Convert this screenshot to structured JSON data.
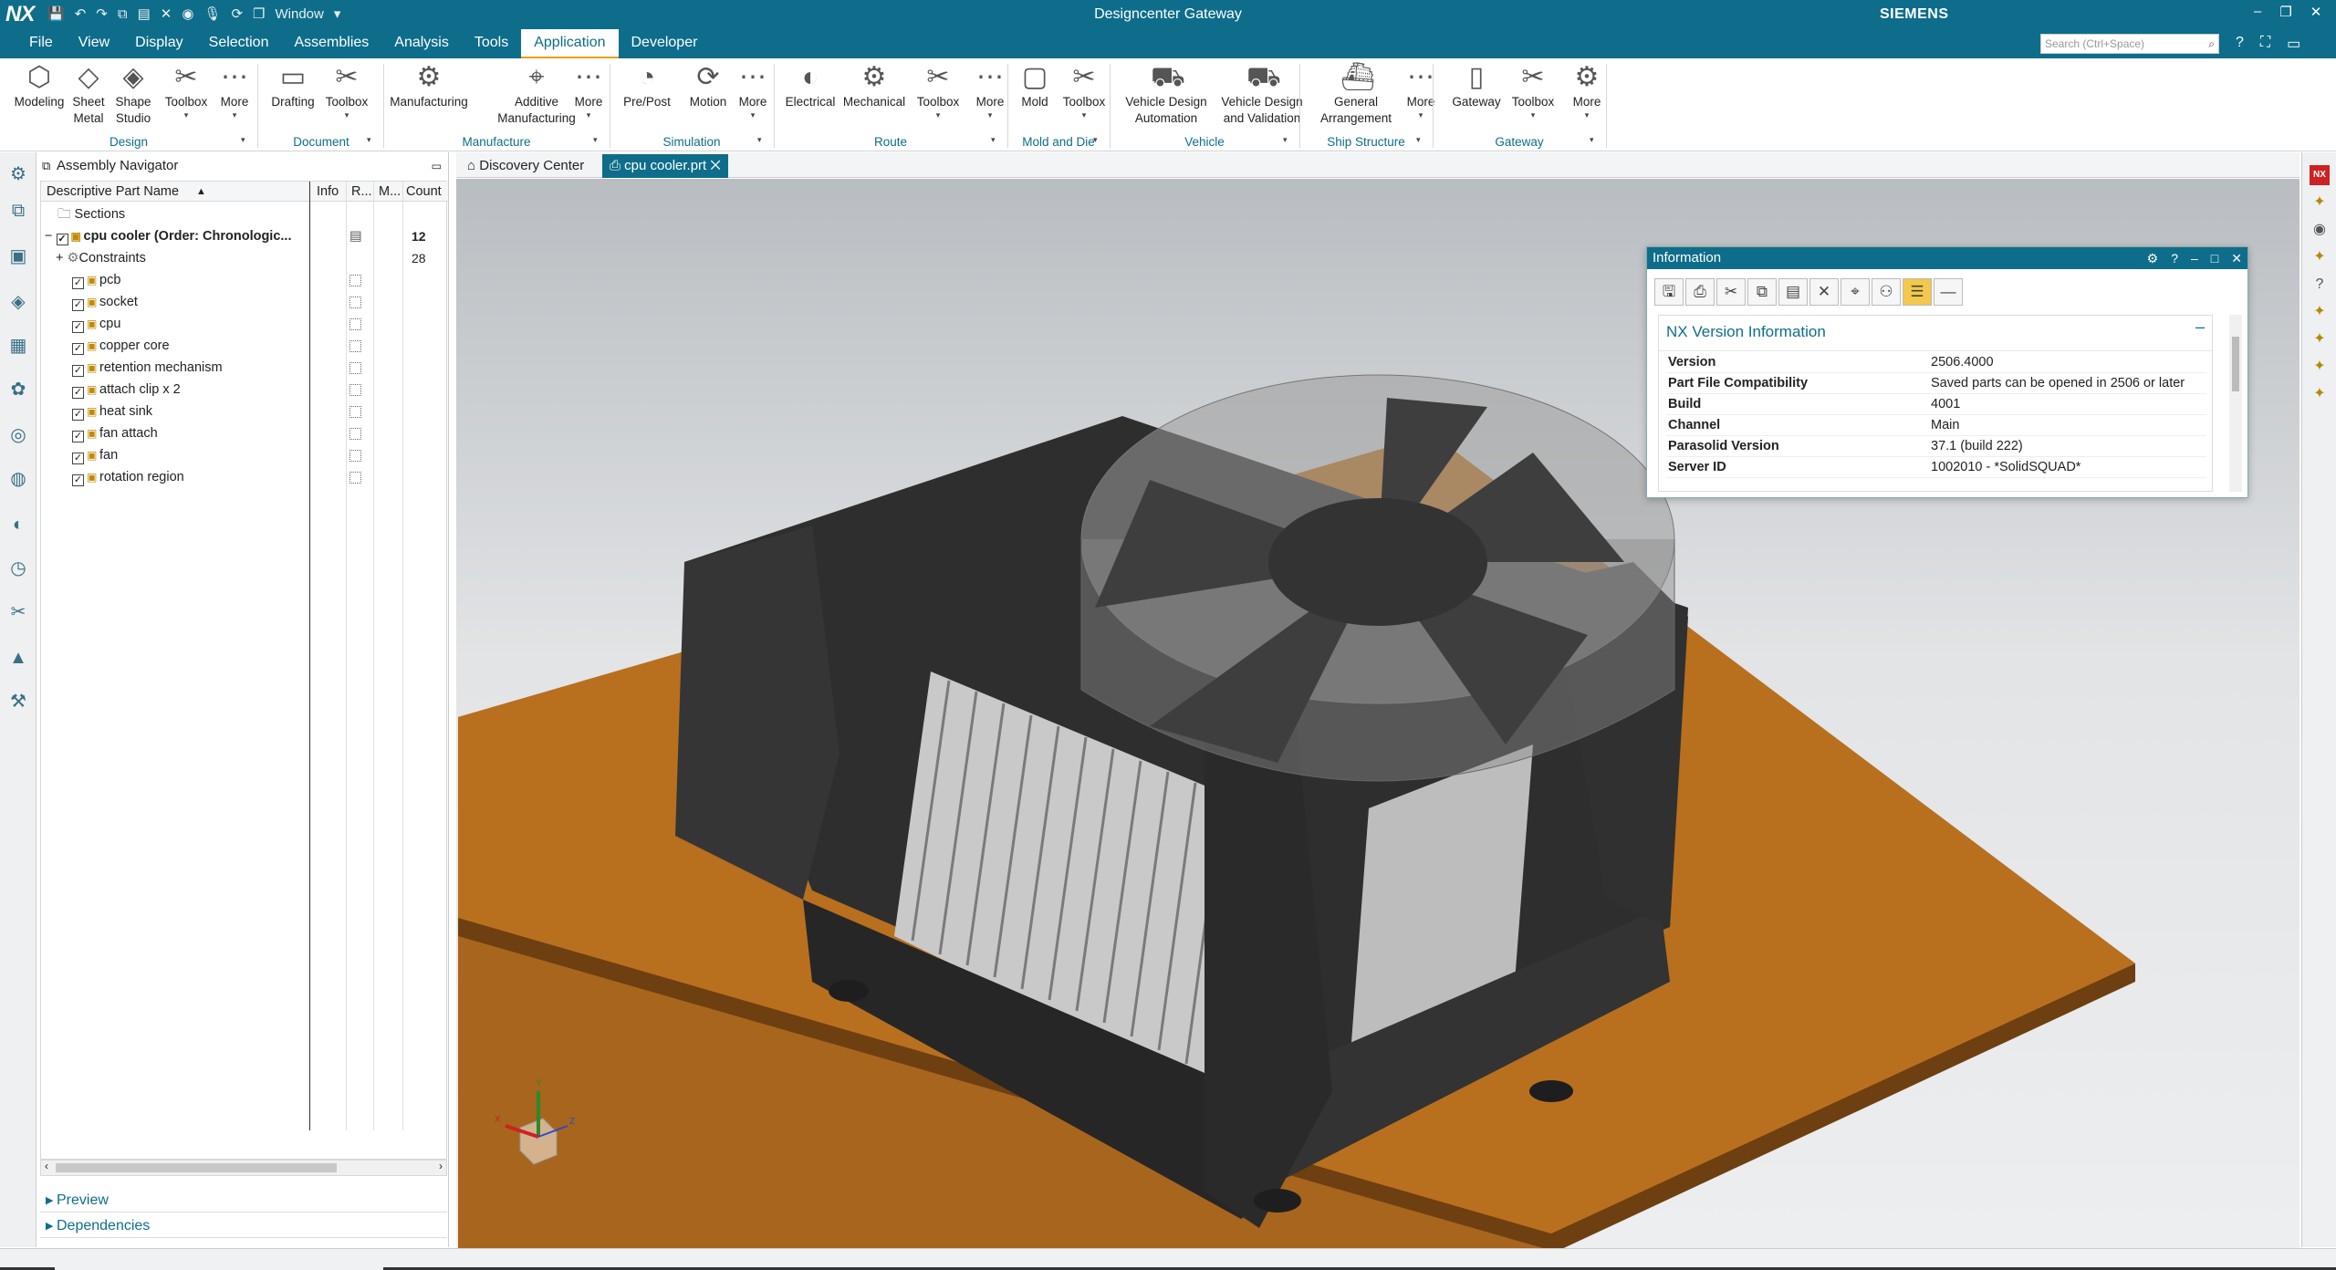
{
  "titlebar": {
    "app_logo": "NX",
    "window_menu": "Window",
    "title": "Designcenter Gateway",
    "brand": "SIEMENS"
  },
  "menubar": {
    "items": [
      "File",
      "View",
      "Display",
      "Selection",
      "Assemblies",
      "Analysis",
      "Tools",
      "Application",
      "Developer"
    ],
    "active": "Application",
    "search_placeholder": "Search (Ctrl+Space)"
  },
  "ribbon": {
    "tools": [
      {
        "label": "Modeling"
      },
      {
        "label": "Sheet\nMetal"
      },
      {
        "label": "Shape\nStudio"
      },
      {
        "label": "Toolbox"
      },
      {
        "label": "More"
      },
      {
        "label": "Drafting"
      },
      {
        "label": "Toolbox"
      },
      {
        "label": "Manufacturing"
      },
      {
        "label": "Additive\nManufacturing"
      },
      {
        "label": "More"
      },
      {
        "label": "Pre/Post"
      },
      {
        "label": "Motion"
      },
      {
        "label": "More"
      },
      {
        "label": "Electrical"
      },
      {
        "label": "Mechanical"
      },
      {
        "label": "Toolbox"
      },
      {
        "label": "More"
      },
      {
        "label": "Mold"
      },
      {
        "label": "Toolbox"
      },
      {
        "label": "Vehicle Design\nAutomation"
      },
      {
        "label": "Vehicle Design\nand Validation"
      },
      {
        "label": "General\nArrangement"
      },
      {
        "label": "More"
      },
      {
        "label": "Gateway"
      },
      {
        "label": "Toolbox"
      },
      {
        "label": "More"
      }
    ],
    "groups": [
      "Design",
      "Document",
      "Manufacture",
      "Simulation",
      "Route",
      "Mold and Die",
      "Vehicle",
      "Ship Structure",
      "Gateway"
    ]
  },
  "navigator": {
    "title": "Assembly Navigator",
    "columns": [
      "Descriptive Part Name",
      "Info",
      "R...",
      "M...",
      "Count"
    ],
    "sections_label": "Sections",
    "root": {
      "name": "cpu cooler (Order: Chronologic...",
      "count": "12"
    },
    "constraints": {
      "name": "Constraints",
      "count": "28"
    },
    "parts": [
      "pcb",
      "socket",
      "cpu",
      "copper core",
      "retention mechanism",
      "attach clip x 2",
      "heat sink",
      "fan attach",
      "fan",
      "rotation region"
    ],
    "preview_label": "Preview",
    "dependencies_label": "Dependencies"
  },
  "tabs": [
    {
      "label": "Discovery Center"
    },
    {
      "label": "cpu cooler.prt"
    }
  ],
  "info_dialog": {
    "title": "Information",
    "heading": "NX Version Information",
    "rows": [
      {
        "k": "Version",
        "v": "2506.4000"
      },
      {
        "k": "Part File Compatibility",
        "v": "Saved parts can be opened in 2506 or later"
      },
      {
        "k": "Build",
        "v": "4001"
      },
      {
        "k": "Channel",
        "v": "Main"
      },
      {
        "k": "Parasolid Version",
        "v": "37.1 (build 222)"
      },
      {
        "k": "Server ID",
        "v": "1002010 - *SolidSQUAD*"
      }
    ]
  },
  "triad": {
    "x": "X",
    "y": "Y",
    "z": "Z"
  },
  "colors": {
    "brand": "#0e6d8a",
    "accent": "#e8a000",
    "board": "#a8651d",
    "cooler": "#3a3a3a"
  }
}
